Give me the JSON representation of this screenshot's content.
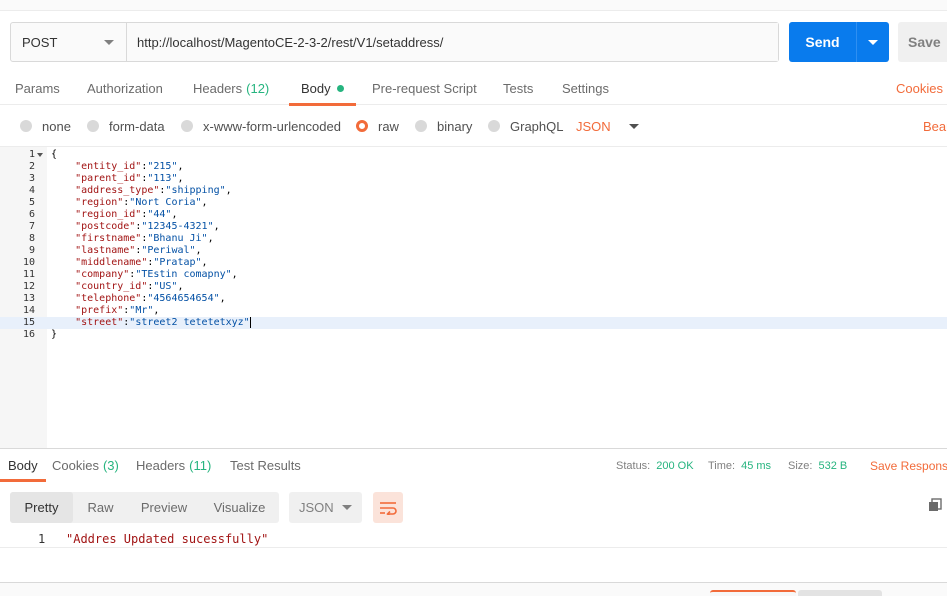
{
  "request": {
    "method": "POST",
    "url": "http://localhost/MagentoCE-2-3-2/rest/V1/setaddress/",
    "send_label": "Send",
    "save_label": "Save"
  },
  "request_tabs": [
    {
      "label": "Params",
      "count": ""
    },
    {
      "label": "Authorization",
      "count": ""
    },
    {
      "label": "Headers",
      "count": "(12)"
    },
    {
      "label": "Body",
      "count": ""
    },
    {
      "label": "Pre-request Script",
      "count": ""
    },
    {
      "label": "Tests",
      "count": ""
    },
    {
      "label": "Settings",
      "count": ""
    }
  ],
  "active_request_tab": "Body",
  "cookies_link": "Cookies",
  "body_types": [
    {
      "label": "none",
      "selected": false
    },
    {
      "label": "form-data",
      "selected": false
    },
    {
      "label": "x-www-form-urlencoded",
      "selected": false
    },
    {
      "label": "raw",
      "selected": true
    },
    {
      "label": "binary",
      "selected": false
    },
    {
      "label": "GraphQL",
      "selected": false
    }
  ],
  "body_format": "JSON",
  "beautify_label": "Beautify",
  "editor": {
    "highlighted_line": 15,
    "lines": [
      {
        "num": "1",
        "text": "{",
        "fold": true
      },
      {
        "num": "2",
        "key": "\"entity_id\"",
        "value": "\"215\"",
        "comma": ","
      },
      {
        "num": "3",
        "key": "\"parent_id\"",
        "value": "\"113\"",
        "comma": ","
      },
      {
        "num": "4",
        "key": "\"address_type\"",
        "value": "\"shipping\"",
        "comma": ","
      },
      {
        "num": "5",
        "key": "\"region\"",
        "value": "\"Nort Coria\"",
        "comma": ","
      },
      {
        "num": "6",
        "key": "\"region_id\"",
        "value": "\"44\"",
        "comma": ","
      },
      {
        "num": "7",
        "key": "\"postcode\"",
        "value": "\"12345-4321\"",
        "comma": ","
      },
      {
        "num": "8",
        "key": "\"firstname\"",
        "value": "\"Bhanu Ji\"",
        "comma": ","
      },
      {
        "num": "9",
        "key": "\"lastname\"",
        "value": "\"Periwal\"",
        "comma": ","
      },
      {
        "num": "10",
        "key": "\"middlename\"",
        "value": "\"Pratap\"",
        "comma": ","
      },
      {
        "num": "11",
        "key": "\"company\"",
        "value": "\"TEstin comapny\"",
        "comma": ","
      },
      {
        "num": "12",
        "key": "\"country_id\"",
        "value": "\"US\"",
        "comma": ","
      },
      {
        "num": "13",
        "key": "\"telephone\"",
        "value": "\"4564654654\"",
        "comma": ","
      },
      {
        "num": "14",
        "key": "\"prefix\"",
        "value": "\"Mr\"",
        "comma": ","
      },
      {
        "num": "15",
        "key": "\"street\"",
        "value": "\"street2 tetetetxyz\"",
        "comma": ""
      },
      {
        "num": "16",
        "text": "}",
        "fold": false
      }
    ]
  },
  "response_tabs": [
    {
      "label": "Body",
      "count": ""
    },
    {
      "label": "Cookies",
      "count": "(3)"
    },
    {
      "label": "Headers",
      "count": "(11)"
    },
    {
      "label": "Test Results",
      "count": ""
    }
  ],
  "response_status": {
    "status_label": "Status:",
    "status_value": "200 OK",
    "time_label": "Time:",
    "time_value": "45 ms",
    "size_label": "Size:",
    "size_value": "532 B"
  },
  "save_response_label": "Save Response",
  "response_views": [
    "Pretty",
    "Raw",
    "Preview",
    "Visualize"
  ],
  "active_response_view": "Pretty",
  "response_format": "JSON",
  "response_body": {
    "line_num": "1",
    "text": "\"Addres Updated sucessfully\""
  },
  "colors": {
    "accent": "#f26b3a",
    "send_button": "#097bed",
    "status_ok": "#26b47f"
  },
  "icons": {
    "wrap_lines": "wrap-lines-icon",
    "copy": "copy-icon"
  }
}
